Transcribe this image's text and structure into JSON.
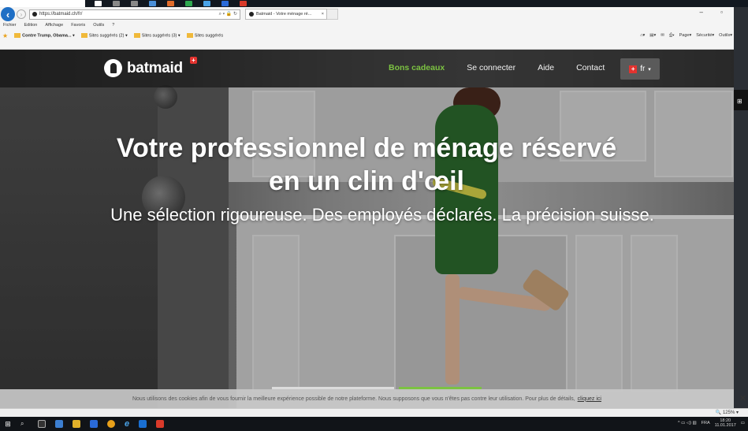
{
  "browser": {
    "address": "https://batmaid.ch/fr/",
    "tab_title": "Batmaid - Votre ménage ré...",
    "menu": [
      "Fichier",
      "Edition",
      "Affichage",
      "Favoris",
      "Outils",
      "?"
    ],
    "favorites": [
      "Contre Trump, Obama...",
      "Sites suggérés (2)",
      "Sites suggérés (3)",
      "Sites suggérés"
    ],
    "command_bar": [
      "Page",
      "Sécurité",
      "Outils"
    ],
    "zoom": "125%"
  },
  "site": {
    "logo_text": "batmaid",
    "nav": {
      "gift": "Bons cadeaux",
      "login": "Se connecter",
      "help": "Aide",
      "contact": "Contact",
      "lang": "fr"
    },
    "hero": {
      "title": "Votre professionnel de ménage réservé en un clin d'œil",
      "subtitle": "Une sélection rigoureuse. Des employés déclarés. La précision suisse."
    },
    "cookie": {
      "text": "Nous utilisons des cookies afin de vous fournir la meilleure expérience possible de notre plateforme. Nous supposons que vous n'êtes pas contre leur utilisation. Pour plus de détails,",
      "link": "cliquez ici"
    },
    "accent_color": "#7cc242",
    "brand_red": "#e3332f"
  },
  "taskbar": {
    "tray_lang": "FRA",
    "time": "18:20",
    "date": "11.01.2017"
  }
}
